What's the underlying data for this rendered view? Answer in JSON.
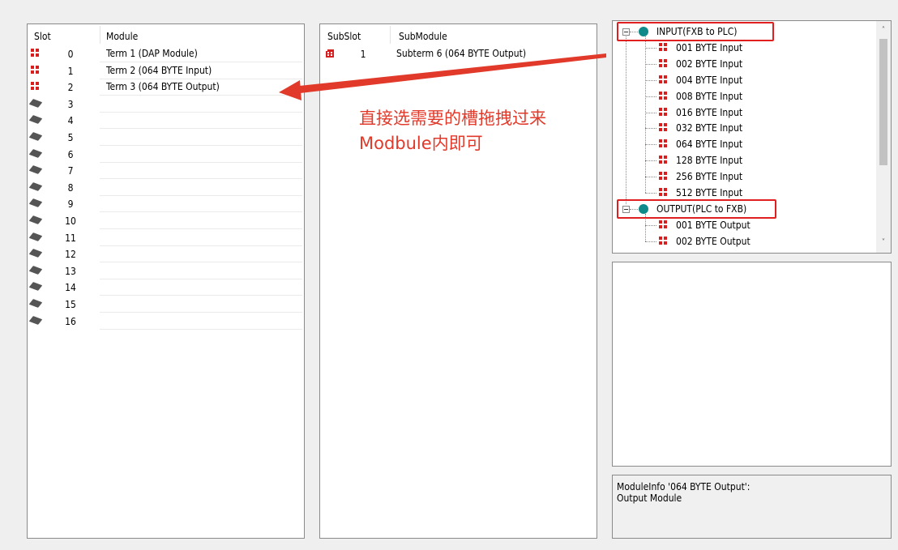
{
  "slot_panel": {
    "headers": {
      "slot": "Slot",
      "module": "Module"
    },
    "rows": [
      {
        "slot": "0",
        "module": "Term 1 (DAP Module)",
        "icon": "module-icon"
      },
      {
        "slot": "1",
        "module": "Term 2 (064 BYTE Input)",
        "icon": "module-icon"
      },
      {
        "slot": "2",
        "module": "Term 3 (064 BYTE Output)",
        "icon": "module-icon"
      },
      {
        "slot": "3",
        "module": "",
        "icon": "empty-slot-icon"
      },
      {
        "slot": "4",
        "module": "",
        "icon": "empty-slot-icon"
      },
      {
        "slot": "5",
        "module": "",
        "icon": "empty-slot-icon"
      },
      {
        "slot": "6",
        "module": "",
        "icon": "empty-slot-icon"
      },
      {
        "slot": "7",
        "module": "",
        "icon": "empty-slot-icon"
      },
      {
        "slot": "8",
        "module": "",
        "icon": "empty-slot-icon"
      },
      {
        "slot": "9",
        "module": "",
        "icon": "empty-slot-icon"
      },
      {
        "slot": "10",
        "module": "",
        "icon": "empty-slot-icon"
      },
      {
        "slot": "11",
        "module": "",
        "icon": "empty-slot-icon"
      },
      {
        "slot": "12",
        "module": "",
        "icon": "empty-slot-icon"
      },
      {
        "slot": "13",
        "module": "",
        "icon": "empty-slot-icon"
      },
      {
        "slot": "14",
        "module": "",
        "icon": "empty-slot-icon"
      },
      {
        "slot": "15",
        "module": "",
        "icon": "empty-slot-icon"
      },
      {
        "slot": "16",
        "module": "",
        "icon": "empty-slot-icon"
      }
    ]
  },
  "subslot_panel": {
    "headers": {
      "subslot": "SubSlot",
      "submodule": "SubModule"
    },
    "rows": [
      {
        "subslot": "1",
        "submodule": "Subterm 6 (064 BYTE Output)",
        "icon": "submodule-icon"
      }
    ]
  },
  "tree": {
    "input_group": {
      "label": "INPUT(FXB to PLC)",
      "items": [
        "001 BYTE Input",
        "002 BYTE Input",
        "004 BYTE Input",
        "008 BYTE Input",
        "016 BYTE Input",
        "032 BYTE Input",
        "064 BYTE Input",
        "128 BYTE Input",
        "256 BYTE Input",
        "512 BYTE Input"
      ]
    },
    "output_group": {
      "label": "OUTPUT(PLC to FXB)",
      "items": [
        "001 BYTE Output",
        "002 BYTE Output"
      ]
    }
  },
  "annotation": {
    "line1": "直接选需要的槽拖拽过来",
    "line2": "Modbule内即可"
  },
  "module_info": {
    "line1": "ModuleInfo '064 BYTE Output':",
    "line2": "Output Module"
  },
  "colors": {
    "accent_red": "#e02020",
    "annotation_red": "#e23a2a",
    "globe_teal": "#0f8a8a"
  }
}
